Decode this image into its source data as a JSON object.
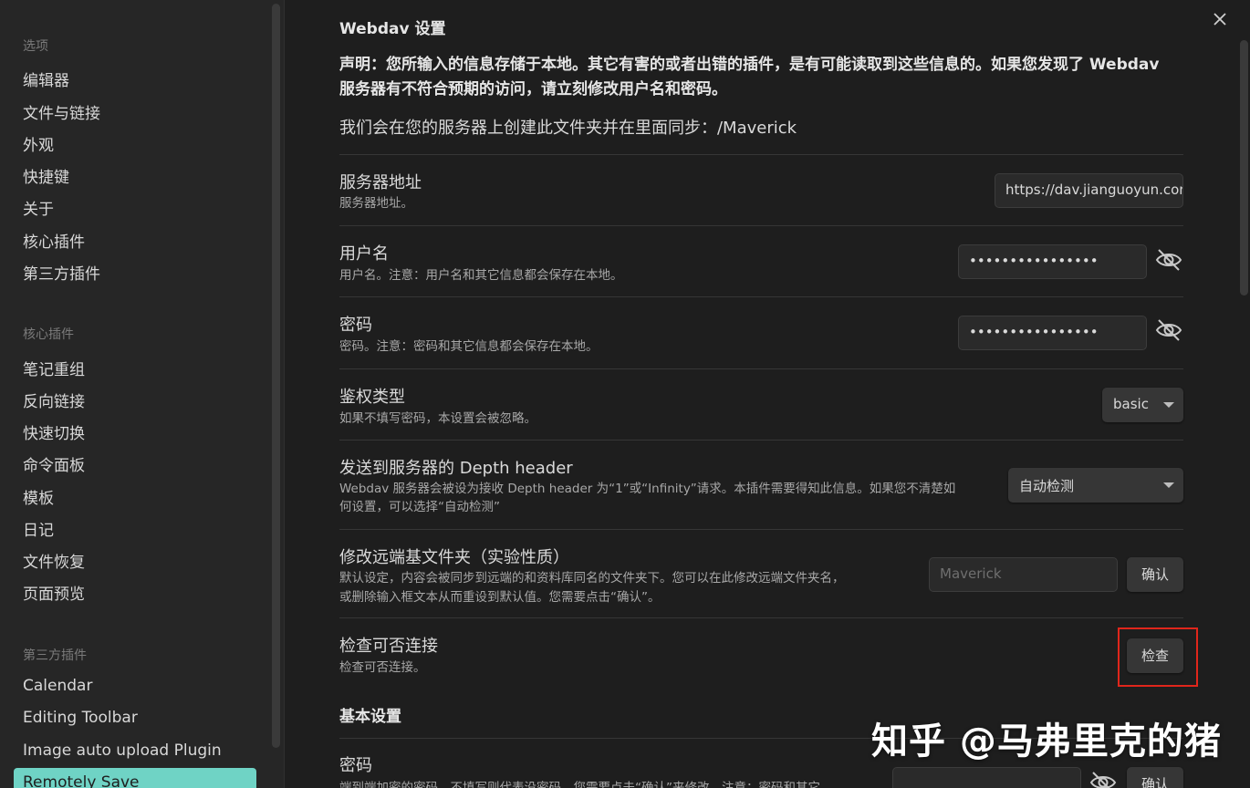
{
  "sidebar": {
    "section_options": "选项",
    "options": [
      "编辑器",
      "文件与链接",
      "外观",
      "快捷键",
      "关于",
      "核心插件",
      "第三方插件"
    ],
    "section_core": "核心插件",
    "core": [
      "笔记重组",
      "反向链接",
      "快速切换",
      "命令面板",
      "模板",
      "日记",
      "文件恢复",
      "页面预览"
    ],
    "section_third": "第三方插件",
    "third": [
      "Calendar",
      "Editing Toolbar",
      "Image auto upload Plugin",
      "Remotely Save"
    ]
  },
  "main": {
    "close_icon": "close-icon",
    "webdav_heading": "Webdav 设置",
    "notice": "声明：您所输入的信息存储于本地。其它有害的或者出错的插件，是有可能读取到这些信息的。如果您发现了 Webdav 服务器有不符合预期的访问，请立刻修改用户名和密码。",
    "folder_note": "我们会在您的服务器上创建此文件夹并在里面同步：/Maverick",
    "server": {
      "name": "服务器地址",
      "desc": "服务器地址。",
      "value": "https://dav.jianguoyun.com/dav/"
    },
    "username": {
      "name": "用户名",
      "desc": "用户名。注意：用户名和其它信息都会保存在本地。",
      "value": "••••••••••••••••"
    },
    "password": {
      "name": "密码",
      "desc": "密码。注意：密码和其它信息都会保存在本地。",
      "value": "••••••••••••••••"
    },
    "auth": {
      "name": "鉴权类型",
      "desc": "如果不填写密码，本设置会被忽略。",
      "value": "basic"
    },
    "depth": {
      "name": "发送到服务器的 Depth header",
      "desc1": "Webdav 服务器会被设为接收 Depth header 为“1”或“Infinity”请求。本插件需要得知此信息。如果您不清楚如",
      "desc2": "何设置，可以选择“自动检测”",
      "value": "自动检测"
    },
    "remote_base": {
      "name": "修改远端基文件夹（实验性质）",
      "desc1": "默认设定，内容会被同步到远端的和资料库同名的文件夹下。您可以在此修改远端文件夹名，",
      "desc2": "或删除输入框文本从而重设到默认值。您需要点击“确认”。",
      "placeholder": "Maverick",
      "button": "确认"
    },
    "check": {
      "name": "检查可否连接",
      "desc": "检查可否连接。",
      "button": "检查"
    },
    "basic_heading": "基本设置",
    "enc_password": {
      "name": "密码",
      "desc": "端到端加密的密码。不填写则代表没密码。您需要点击“确认”来修改。注意：密码和其它",
      "button": "确认"
    },
    "highlight_color": "#e0261b"
  },
  "watermark": "知乎 @马弗里克的猪"
}
